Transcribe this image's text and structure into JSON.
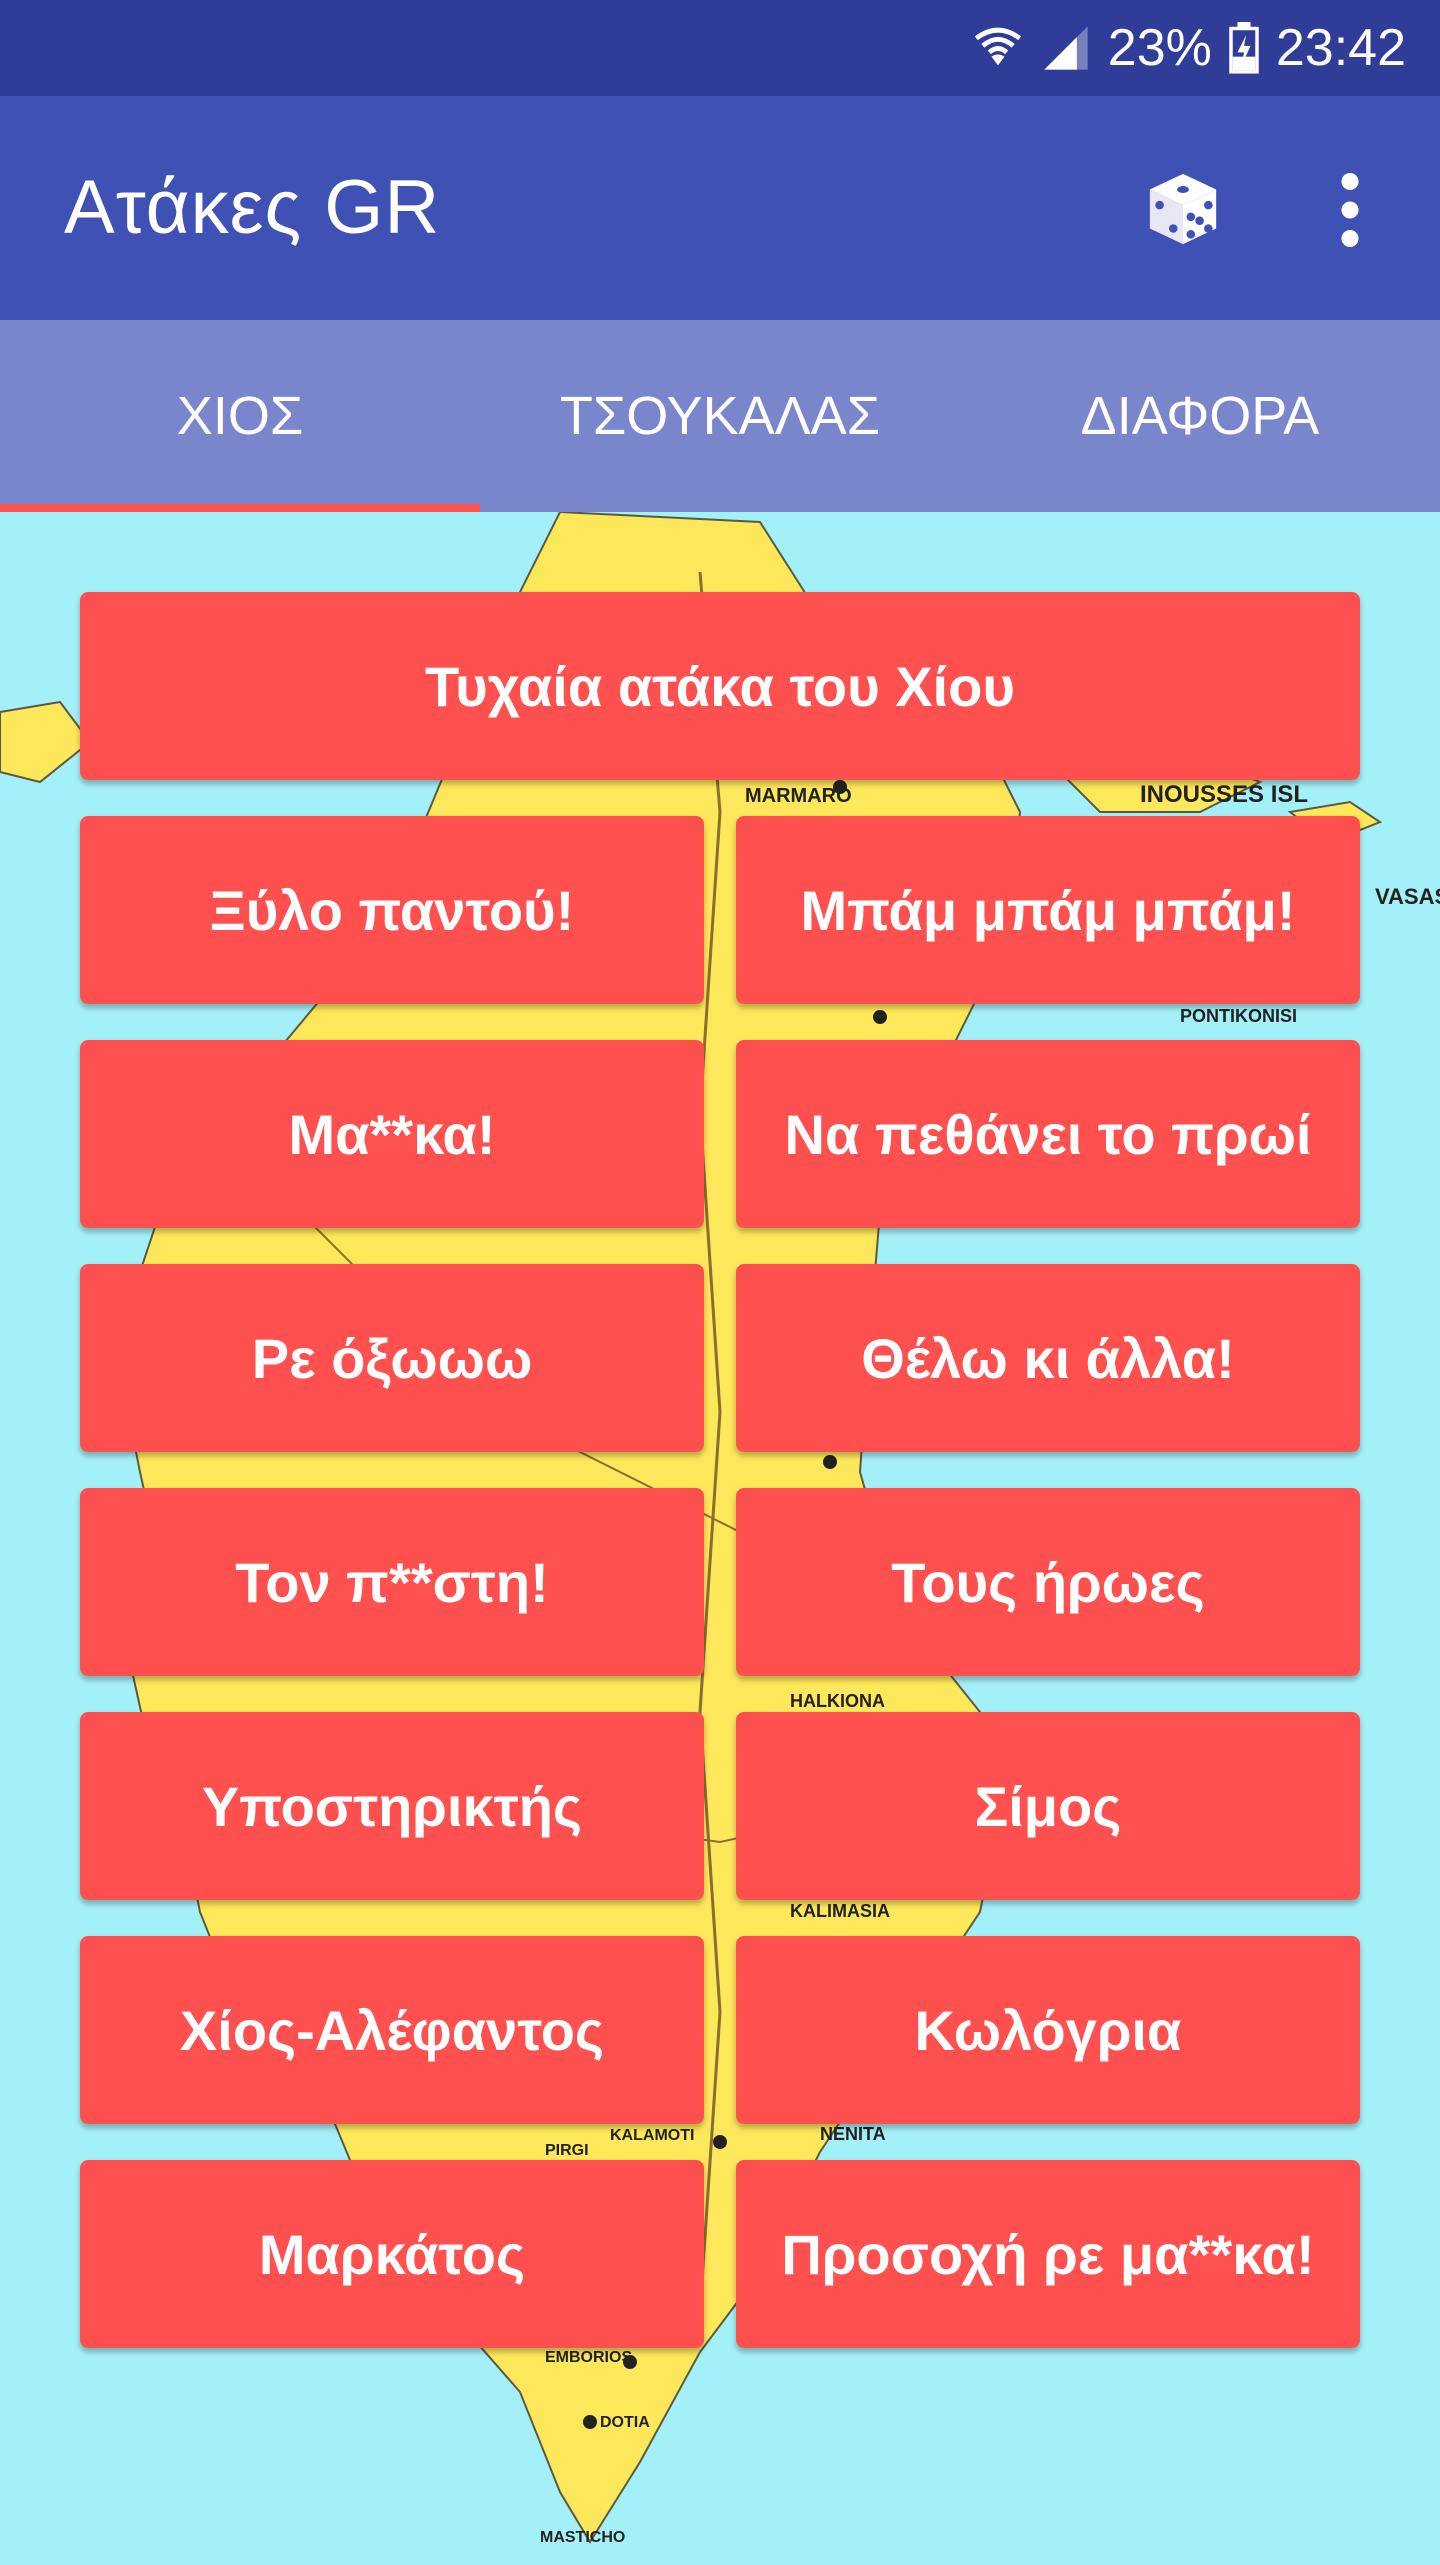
{
  "status": {
    "battery": "23%",
    "time": "23:42"
  },
  "app": {
    "title": "Ατάκες GR"
  },
  "tabs": [
    "ΧΙΟΣ",
    "ΤΣΟΥΚΑΛΑΣ",
    "ΔΙΑΦΟΡΑ"
  ],
  "main": {
    "random_button": "Τυχαία ατάκα του Χίου",
    "buttons": [
      "Ξύλο παντού!",
      "Μπάμ μπάμ μπάμ!",
      "Μα**κα!",
      "Να πεθάνει το πρωί",
      "Ρε όξωωω",
      "Θέλω κι άλλα!",
      "Τον π**στη!",
      "Τους ήρωες",
      "Υποστηρικτής",
      "Σίμος",
      "Χίος-Αλέφαντος",
      "Κωλόγρια",
      "Μαρκάτος",
      "Προσοχή ρε μα**κα!"
    ]
  },
  "map_labels": [
    "MARMARO",
    "INOUSSES ISL",
    "PONTIKONISI",
    "HALKIONA",
    "KALIMASIA",
    "NENITA",
    "KALAMOTI",
    "EMBORIOS",
    "MASTICHO",
    "PIRGI",
    "DOTIA",
    "VASAS"
  ],
  "colors": {
    "status_bar": "#2f3d99",
    "app_bar": "#3f51b5",
    "tabs": "#7986cb",
    "indicator": "#ff5252",
    "button": "#ff5050",
    "sea": "#a4f0f8",
    "land": "#fde75a"
  }
}
